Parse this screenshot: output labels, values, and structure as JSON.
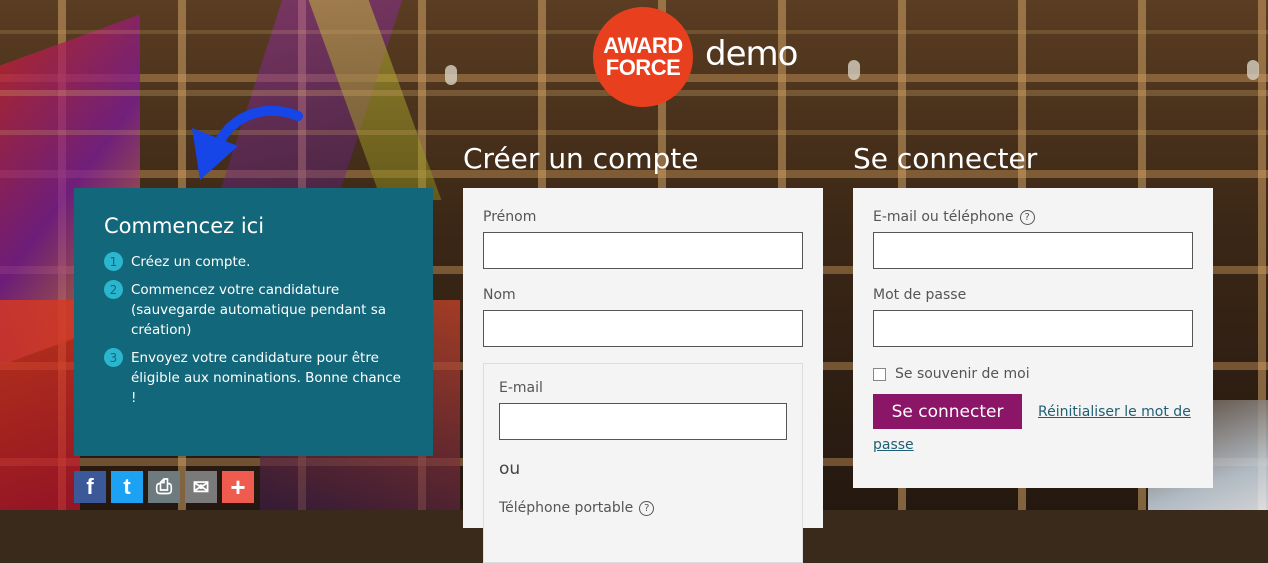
{
  "logo": {
    "line1": "AWARD",
    "line2": "FORCE",
    "suffix": "demo"
  },
  "start_panel": {
    "title": "Commencez ici",
    "steps": [
      {
        "num": "1",
        "text": "Créez un compte."
      },
      {
        "num": "2",
        "text": "Commencez votre candidature (sauvegarde automatique pendant sa création)"
      },
      {
        "num": "3",
        "text": "Envoyez votre candidature pour être éligible aux nominations. Bonne chance !"
      }
    ]
  },
  "share_buttons": [
    {
      "icon": "facebook-icon",
      "glyph": "f",
      "color": "#3b5998"
    },
    {
      "icon": "twitter-icon",
      "glyph": "t",
      "color": "#1da1f2"
    },
    {
      "icon": "print-icon",
      "glyph": "⎙",
      "color": "#6e7b7e"
    },
    {
      "icon": "email-icon",
      "glyph": "✉",
      "color": "#7a7a7a"
    },
    {
      "icon": "plus-icon",
      "glyph": "+",
      "color": "#f05b4f"
    }
  ],
  "register": {
    "title": "Créer un compte",
    "first_name_label": "Prénom",
    "last_name_label": "Nom",
    "email_label": "E-mail",
    "or_text": "ou",
    "mobile_label": "Téléphone portable"
  },
  "login": {
    "title": "Se connecter",
    "email_phone_label": "E-mail ou téléphone",
    "password_label": "Mot de passe",
    "remember_label": "Se souvenir de moi",
    "submit_label": "Se connecter",
    "reset_link": "Réinitialiser le mot de passe"
  },
  "colors": {
    "panel": "#13677a",
    "logo": "#e8401e",
    "button": "#8b1566",
    "arrow": "#1645e8"
  }
}
